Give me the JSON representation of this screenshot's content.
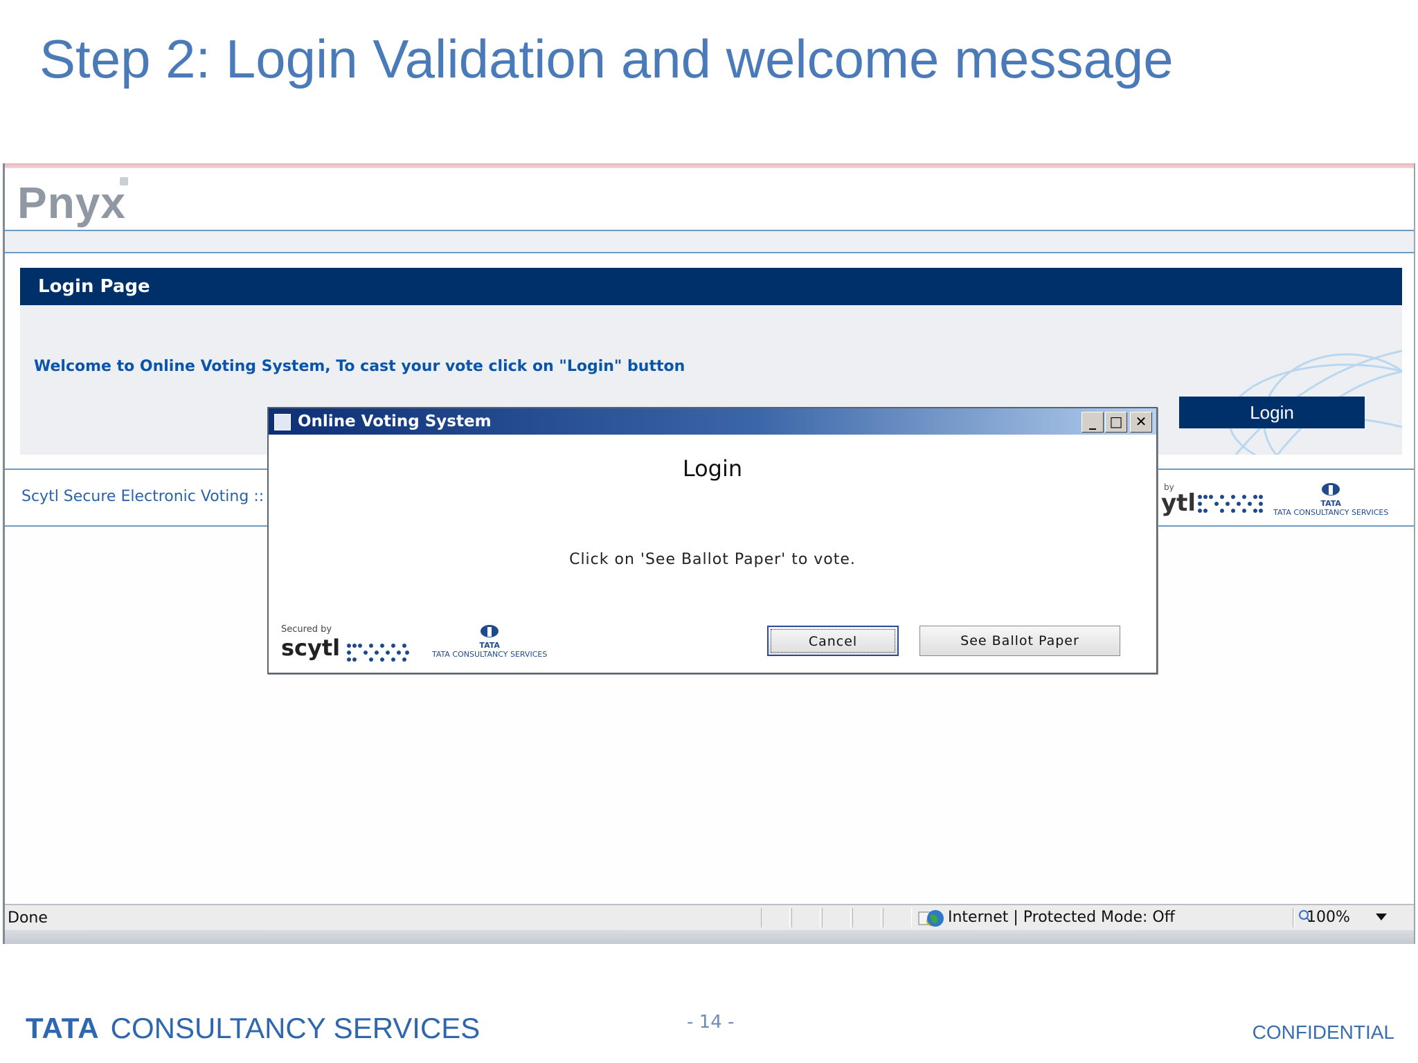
{
  "slide": {
    "title": "Step 2: Login Validation and welcome message",
    "footer_brand_bold": "TATA",
    "footer_brand": "CONSULTANCY SERVICES",
    "page_number": "- 14 -",
    "confidential": "CONFIDENTIAL"
  },
  "app": {
    "logo": "Pnyx",
    "login_bar_title": "Login Page",
    "welcome_text": "Welcome to Online Voting System, To cast your vote click on \"Login\" button",
    "login_button": "Login",
    "footer_text": "Scytl Secure Electronic Voting :: ww",
    "footer_by": "by",
    "footer_scytl": "ytl",
    "tcs_small_top": "TATA",
    "tcs_small_bottom": "TATA CONSULTANCY SERVICES"
  },
  "dialog": {
    "title": "Online Voting System",
    "heading": "Login",
    "message": "Click on 'See Ballot Paper' to vote.",
    "cancel_button": "Cancel",
    "see_ballot_button": "See Ballot Paper",
    "secured_by": "Secured by",
    "scytl": "scytl",
    "tcs_top": "TATA",
    "tcs_bottom": "TATA CONSULTANCY SERVICES",
    "minimize": "_",
    "maximize": "□",
    "close": "✕"
  },
  "statusbar": {
    "status": "Done",
    "zone": "Internet | Protected Mode: Off",
    "zoom": "100%"
  },
  "colors": {
    "title_blue": "#4a7ab8",
    "navy": "#003069",
    "link_blue": "#0a55a8"
  },
  "icons": [
    "globe-icon",
    "lock-warning-icon",
    "zoom-icon",
    "dropdown-icon",
    "window-icon"
  ]
}
